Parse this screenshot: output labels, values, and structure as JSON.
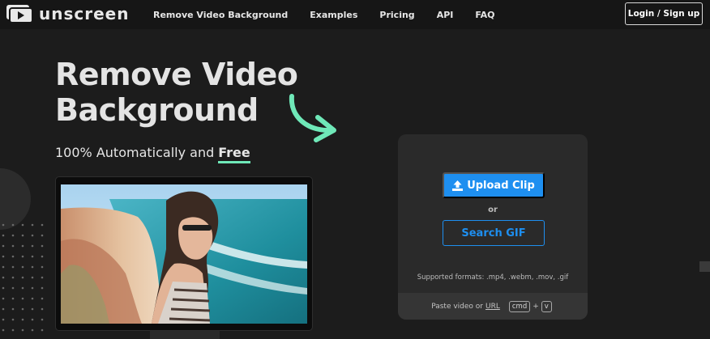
{
  "nav": {
    "logo_text": "unscreen",
    "links": [
      "Remove Video Background",
      "Examples",
      "Pricing",
      "API",
      "FAQ"
    ],
    "login_label": "Login / Sign up"
  },
  "hero": {
    "title_line1": "Remove Video",
    "title_line2": "Background",
    "subtitle_prefix": "100% Automatically and",
    "subtitle_highlight": "Free"
  },
  "upload": {
    "upload_label": "Upload Clip",
    "or_label": "or",
    "search_label": "Search GIF",
    "formats_text": "Supported formats: .mp4, .webm, .mov, .gif",
    "paste_prefix": "Paste video or",
    "paste_link": "URL",
    "key_cmd": "cmd",
    "key_plus": "+",
    "key_v": "v"
  },
  "colors": {
    "accent_blue": "#1e8ff0",
    "accent_green": "#6fe8b8",
    "background": "#1c1c1c",
    "nav_background": "#161616",
    "panel": "#2a2a2a"
  },
  "icons": {
    "logo": "play-window-icon",
    "upload": "upload-arrow-icon",
    "arrow": "curved-arrow-icon"
  }
}
